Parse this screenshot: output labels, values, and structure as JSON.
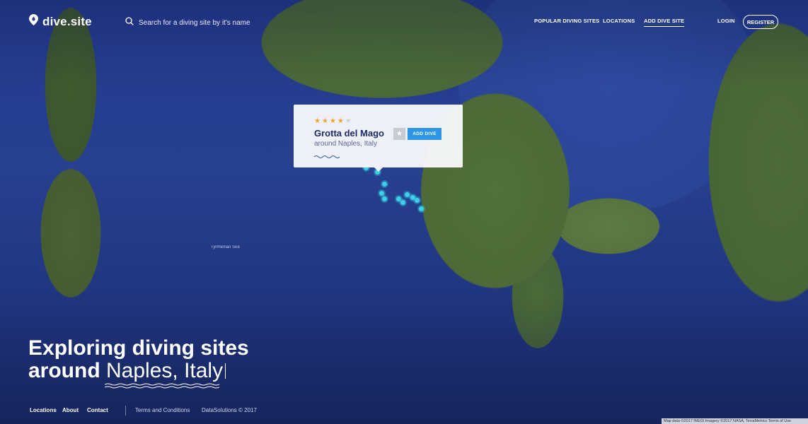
{
  "brand": {
    "name": "dive.site"
  },
  "search": {
    "placeholder": "Search for a diving site by it's name"
  },
  "nav": {
    "popular": "POPULAR DIVING SITES",
    "locations": "LOCATIONS",
    "add_dive_site": "ADD DIVE SITE",
    "login": "LOGIN",
    "register": "REGISTER"
  },
  "map": {
    "sea_label": "Tyrrhenian Sea",
    "attribution": "Map data ©2017 INEGI Imagery ©2017 NASA, TerraMetrics   Terms of Use"
  },
  "popup": {
    "rating": 4,
    "rating_max": 5,
    "site_name": "Grotta del Mago",
    "location": "around Naples, Italy",
    "add_dive_label": "ADD DIVE"
  },
  "hero": {
    "line1": "Exploring diving sites",
    "line2_bold": "around",
    "line2_thin": "Naples, Italy"
  },
  "footer": {
    "locations": "Locations",
    "about": "About",
    "contact": "Contact",
    "terms": "Terms and Conditions",
    "copyright": "DataSolutions © 2017"
  },
  "colors": {
    "accent": "#2c95e6",
    "star": "#f0a32c",
    "marker": "#3ad0e8",
    "title_text": "#1b2c66"
  },
  "icons": {
    "logo": "map-pin-drop-icon",
    "search": "search-icon",
    "favorite": "star-icon"
  }
}
